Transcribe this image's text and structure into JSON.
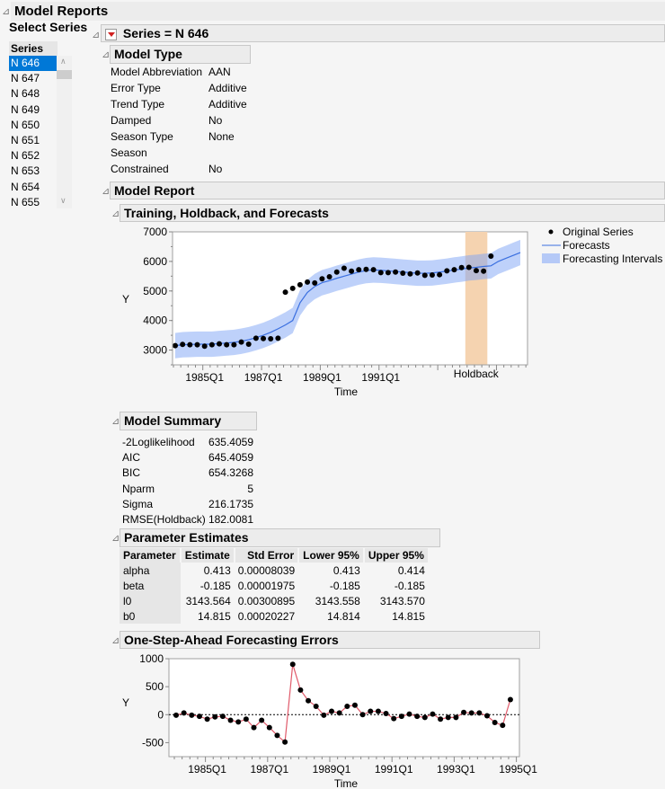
{
  "window": {
    "title": "Model Reports",
    "select_series_label": "Select Series",
    "series_list_header": "Series",
    "series_list": [
      "N 646",
      "N 647",
      "N 648",
      "N 649",
      "N 650",
      "N 651",
      "N 652",
      "N 653",
      "N 654",
      "N 655"
    ],
    "selected_series": "N 646"
  },
  "series_header": "Series = N 646",
  "model_type": {
    "title": "Model Type",
    "rows": [
      {
        "label": "Model Abbreviation",
        "value": "AAN"
      },
      {
        "label": "Error Type",
        "value": "Additive"
      },
      {
        "label": "Trend Type",
        "value": "Additive"
      },
      {
        "label": "Damped",
        "value": "No"
      },
      {
        "label": "Season Type",
        "value": "None"
      },
      {
        "label": "Season",
        "value": ""
      },
      {
        "label": "Constrained",
        "value": "No"
      }
    ]
  },
  "model_report": {
    "title": "Model Report",
    "forecast_section_title": "Training, Holdback, and Forecasts",
    "summary": {
      "title": "Model Summary",
      "rows": [
        {
          "label": "-2Loglikelihood",
          "value": "635.4059"
        },
        {
          "label": "AIC",
          "value": "645.4059"
        },
        {
          "label": "BIC",
          "value": "654.3268"
        },
        {
          "label": "Nparm",
          "value": "5"
        },
        {
          "label": "Sigma",
          "value": "216.1735"
        },
        {
          "label": "RMSE(Holdback)",
          "value": "182.0081"
        }
      ]
    },
    "parameter_estimates": {
      "title": "Parameter Estimates",
      "columns": [
        "Parameter",
        "Estimate",
        "Std Error",
        "Lower 95%",
        "Upper 95%"
      ],
      "rows": [
        [
          "alpha",
          "0.413",
          "0.00008039",
          "0.413",
          "0.414"
        ],
        [
          "beta",
          "-0.185",
          "0.00001975",
          "-0.185",
          "-0.185"
        ],
        [
          "l0",
          "3143.564",
          "0.00300895",
          "3143.558",
          "3143.570"
        ],
        [
          "b0",
          "14.815",
          "0.00020227",
          "14.814",
          "14.815"
        ]
      ]
    },
    "errors_section_title": "One-Step-Ahead Forecasting Errors"
  },
  "chart_data": [
    {
      "type": "line",
      "title": "Training, Holdback, and Forecasts",
      "xlabel": "Time",
      "ylabel": "Y",
      "ylim": [
        2500,
        7000
      ],
      "yticks": [
        3000,
        4000,
        5000,
        6000,
        7000
      ],
      "xtick_labels": [
        "1985Q1",
        "1987Q1",
        "1989Q1",
        "1991Q1"
      ],
      "holdback_label": "Holdback",
      "holdback_quarter_range": [
        40,
        43
      ],
      "legend": [
        "Original Series",
        "Forecasts",
        "Forecasting Intervals"
      ],
      "legend_position": "right",
      "x_start": "1984Q1",
      "original_series": [
        3150,
        3190,
        3180,
        3180,
        3130,
        3180,
        3210,
        3180,
        3180,
        3270,
        3200,
        3400,
        3390,
        3380,
        3400,
        4960,
        5090,
        5210,
        5300,
        5270,
        5410,
        5480,
        5640,
        5770,
        5670,
        5720,
        5730,
        5720,
        5620,
        5620,
        5640,
        5600,
        5580,
        5610,
        5530,
        5540,
        5550,
        5680,
        5720,
        5790,
        5800,
        5690,
        5670,
        6180
      ],
      "forecasts": [
        3150,
        3180,
        3190,
        3200,
        3200,
        3200,
        3220,
        3240,
        3260,
        3300,
        3350,
        3420,
        3500,
        3600,
        3720,
        3850,
        4000,
        4600,
        4950,
        5150,
        5280,
        5350,
        5430,
        5500,
        5570,
        5640,
        5690,
        5710,
        5700,
        5680,
        5660,
        5640,
        5620,
        5600,
        5600,
        5610,
        5640,
        5670,
        5710,
        5740,
        5780,
        5800,
        5830,
        5850,
        6000,
        6100,
        6200,
        6300
      ],
      "interval_halfwidth": 430
    },
    {
      "type": "line",
      "title": "One-Step-Ahead Forecasting Errors",
      "xlabel": "Time",
      "ylabel": "Y",
      "ylim": [
        -750,
        1000
      ],
      "yticks": [
        -500,
        0,
        500,
        1000
      ],
      "xtick_labels": [
        "1985Q1",
        "1987Q1",
        "1989Q1",
        "1991Q1",
        "1993Q1",
        "1995Q1"
      ],
      "x_start": "1984Q1",
      "reference_line": 0,
      "errors": [
        -10,
        30,
        -10,
        -30,
        -80,
        -40,
        -30,
        -100,
        -130,
        -80,
        -230,
        -100,
        -230,
        -370,
        -490,
        900,
        440,
        250,
        150,
        -10,
        60,
        30,
        150,
        170,
        0,
        60,
        60,
        20,
        -70,
        -30,
        10,
        -30,
        -50,
        10,
        -80,
        -50,
        -50,
        40,
        30,
        30,
        -20,
        -140,
        -190,
        270
      ]
    }
  ]
}
